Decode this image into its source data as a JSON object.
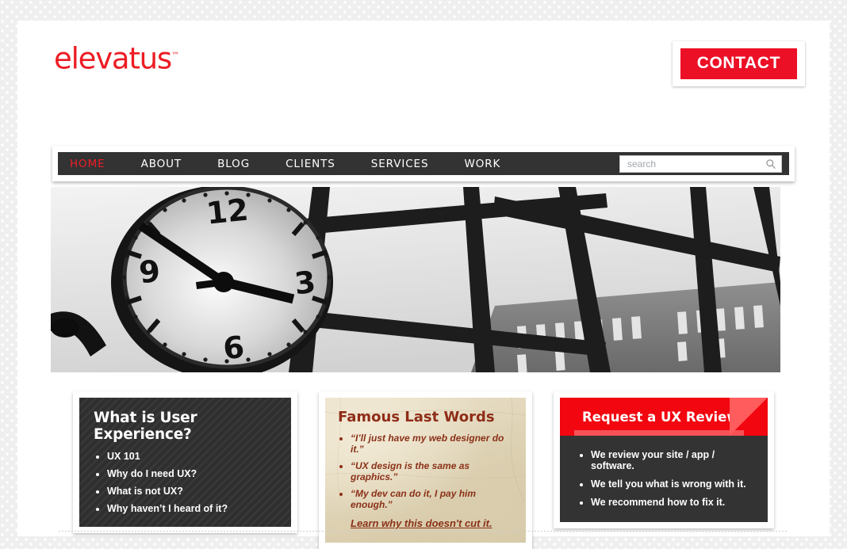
{
  "brand": {
    "logo_text": "elevatus",
    "logo_tm": "™",
    "accent_red": "#ec1c24",
    "nav_dark": "#333333"
  },
  "header": {
    "contact_label": "CONTACT"
  },
  "nav": {
    "items": [
      {
        "label": "HOME",
        "active": true
      },
      {
        "label": "ABOUT",
        "active": false
      },
      {
        "label": "BLOG",
        "active": false
      },
      {
        "label": "CLIENTS",
        "active": false
      },
      {
        "label": "SERVICES",
        "active": false
      },
      {
        "label": "WORK",
        "active": false
      }
    ],
    "search": {
      "placeholder": "search",
      "value": "",
      "icon": "search-icon"
    }
  },
  "hero": {
    "alt": "Black and white photograph of a large wall clock in front of a glass atrium with dark window mullions"
  },
  "cards": [
    {
      "id": "what-is-user-experience",
      "title": "What is User Experience?",
      "bullets": [
        "UX 101",
        "Why do I need UX?",
        "What is not UX?",
        "Why haven’t I heard of it?"
      ]
    },
    {
      "id": "famous-last-words",
      "title": "Famous Last Words",
      "bullets": [
        "“I’ll just have my web designer do it.”",
        "“UX design is the same as graphics.”",
        "“My dev can do it, I pay him enough.”"
      ],
      "link_label": "Learn why this doesn't cut it."
    },
    {
      "id": "request-a-ux-review",
      "title": "Request a UX Review",
      "bullets": [
        "We review your site / app / software.",
        "We tell you what is wrong with it.",
        "We recommend how to fix it."
      ]
    }
  ]
}
